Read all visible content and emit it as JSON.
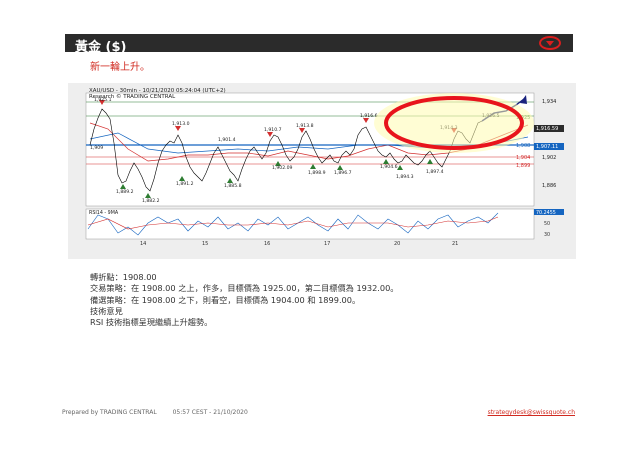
{
  "header": {
    "title": "黃金 ($)"
  },
  "subtitle": "新一輪上升。",
  "chart": {
    "header_line1": "XAU/USD - 30min - 10/21/2020 05:24:04 (UTC+2)",
    "header_line2": "Research © TRADING CENTRAL",
    "point_labels": [
      "1,925.1",
      "1,913.0",
      "1,901.4",
      "1,910.7",
      "1,913.8",
      "1,916.6",
      "1,914.3",
      "1,926.5",
      "1,909",
      "1,889.2",
      "1,882.2",
      "1,891.2",
      "1,885.8",
      "1,902.09",
      "1,898.9",
      "1,896.7",
      "1,904.6",
      "1,894.3",
      "1,897.4"
    ],
    "price_axis": [
      "1,934",
      "1,925",
      "1,916.59",
      "1,908",
      "1,907.11",
      "1,904",
      "1,899",
      "1,902",
      "1,886"
    ],
    "date_axis": [
      "14",
      "15",
      "16",
      "17",
      "20",
      "21"
    ],
    "rsi_title": "RSI14 - 9MA",
    "rsi_axis": [
      "70.2455",
      "50",
      "30"
    ],
    "colors": {
      "resistance": "#2e7d32",
      "support": "#d32f2f",
      "pivot": "#1565c0",
      "price": "#000000",
      "ma_red": "#d32f2f",
      "ma_blue": "#1565c0",
      "highlight": "#e8141c"
    }
  },
  "analysis": {
    "pivot": "轉折點：1908.00",
    "strategy": "交易策略：在 1908.00 之上，作多，目標價為 1925.00，第二目標價為 1932.00。",
    "alternative": "備選策略：在 1908.00 之下，則看空，目標價為 1904.00 和 1899.00。",
    "comment_title": "技術意見",
    "comment": "RSI 技術指標呈現繼續上升趨勢。"
  },
  "footer": {
    "prepared": "Prepared by TRADING CENTRAL",
    "timestamp": "05:57 CEST - 21/10/2020",
    "email": "strategydesk@swissquote.ch"
  }
}
